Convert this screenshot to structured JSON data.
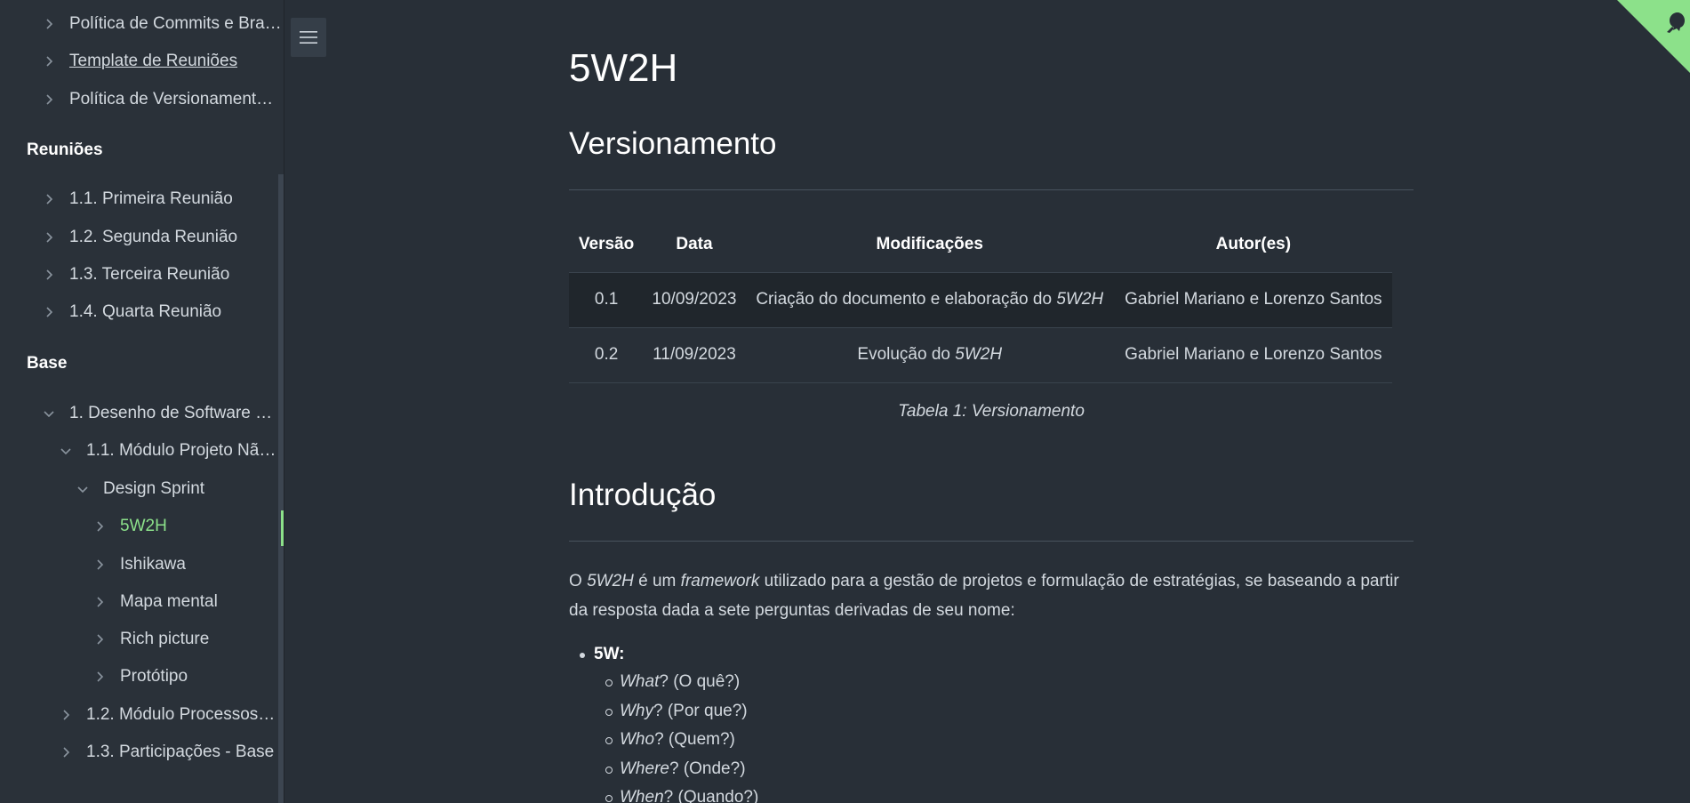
{
  "sidebar": {
    "items_top": [
      {
        "label": "Política de Commits e Bra…"
      },
      {
        "label": "Template de Reuniões"
      },
      {
        "label": "Política de Versionament…"
      }
    ],
    "section_reunioes": "Reuniões",
    "reunioes": [
      {
        "label": "1.1. Primeira Reunião"
      },
      {
        "label": "1.2. Segunda Reunião"
      },
      {
        "label": "1.3. Terceira Reunião"
      },
      {
        "label": "1.4. Quarta Reunião"
      }
    ],
    "section_base": "Base",
    "base": [
      {
        "label": "1. Desenho de Software (…"
      },
      {
        "label": "1.1. Módulo Projeto Nã…"
      },
      {
        "label": "Design Sprint"
      },
      {
        "label": "5W2H"
      },
      {
        "label": "Ishikawa"
      },
      {
        "label": "Mapa mental"
      },
      {
        "label": "Rich picture"
      },
      {
        "label": "Protótipo"
      },
      {
        "label": "1.2. Módulo Processos/…"
      },
      {
        "label": "1.3. Participações - Base"
      }
    ]
  },
  "page": {
    "title": "5W2H",
    "section_versionamento": "Versionamento",
    "table": {
      "headers": [
        "Versão",
        "Data",
        "Modificações",
        "Autor(es)"
      ],
      "rows": [
        {
          "versao": "0.1",
          "data": "10/09/2023",
          "mod_prefix": "Criação do documento e elaboração do ",
          "mod_em": "5W2H",
          "autores": "Gabriel Mariano e Lorenzo Santos"
        },
        {
          "versao": "0.2",
          "data": "11/09/2023",
          "mod_prefix": "Evolução do ",
          "mod_em": "5W2H",
          "autores": "Gabriel Mariano e Lorenzo Santos"
        }
      ],
      "caption": "Tabela 1: Versionamento"
    },
    "section_introducao": "Introdução",
    "intro": {
      "p1": "O ",
      "em1": "5W2H",
      "p2": " é um ",
      "em2": "framework",
      "p3": " utilizado para a gestão de projetos e formulação de estratégias, se baseando a partir da resposta dada a sete perguntas derivadas de seu nome:"
    },
    "list_5w": {
      "label": "5W:",
      "items": [
        {
          "em": "What",
          "rest": "? (O quê?)"
        },
        {
          "em": "Why",
          "rest": "? (Por que?)"
        },
        {
          "em": "Who",
          "rest": "? (Quem?)"
        },
        {
          "em": "Where",
          "rest": "? (Onde?)"
        },
        {
          "em": "When",
          "rest": "? (Quando?)"
        }
      ]
    }
  },
  "colors": {
    "accent": "#8ce18a",
    "background": "#282f37",
    "sidebar": "#2a3139"
  }
}
